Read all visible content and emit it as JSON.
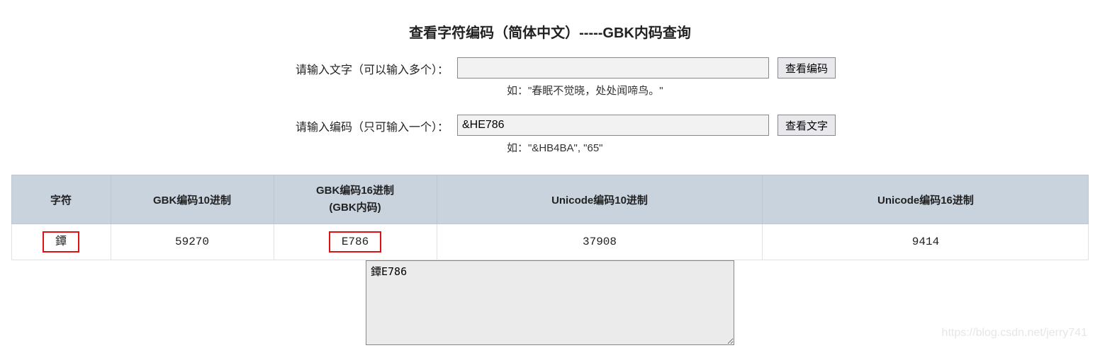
{
  "title": "查看字符编码（简体中文）-----GBK内码查询",
  "form": {
    "text_label": "请输入文字（可以输入多个）：",
    "text_value": "",
    "text_hint": "如：\"春眠不觉晓，处处闻啼鸟。\"",
    "code_label": "请输入编码（只可输入一个）：",
    "code_value": "&HE786",
    "code_hint": "如：\"&HB4BA\", \"65\"",
    "btn_view_code": "查看编码",
    "btn_view_char": "查看文字"
  },
  "table": {
    "headers": {
      "char": "字符",
      "gbk10": "GBK编码10进制",
      "gbk16_line1": "GBK编码16进制",
      "gbk16_line2": "(GBK内码)",
      "uni10": "Unicode编码10进制",
      "uni16": "Unicode编码16进制"
    },
    "row": {
      "char": "鐔",
      "gbk10": "59270",
      "gbk16": "E786",
      "uni10": "37908",
      "uni16": "9414"
    }
  },
  "output": "鐔E786",
  "watermark": "https://blog.csdn.net/jerry741"
}
